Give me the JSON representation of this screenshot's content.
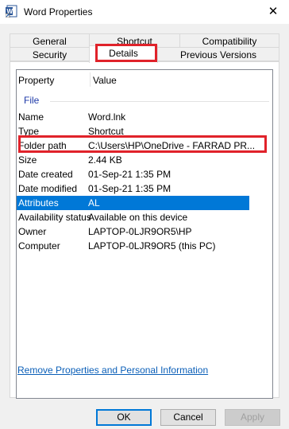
{
  "window": {
    "title": "Word Properties",
    "close_glyph": "✕"
  },
  "tabs": {
    "row1": [
      "General",
      "Shortcut",
      "Compatibility"
    ],
    "row2": [
      "Security",
      "Details",
      "Previous Versions"
    ],
    "active": "Details"
  },
  "columns": {
    "property": "Property",
    "value": "Value"
  },
  "group": "File",
  "rows": [
    {
      "property": "Name",
      "value": "Word.lnk"
    },
    {
      "property": "Type",
      "value": "Shortcut"
    },
    {
      "property": "Folder path",
      "value": "C:\\Users\\HP\\OneDrive - FARRAD PR..."
    },
    {
      "property": "Size",
      "value": "2.44 KB"
    },
    {
      "property": "Date created",
      "value": "01-Sep-21 1:35 PM"
    },
    {
      "property": "Date modified",
      "value": "01-Sep-21 1:35 PM"
    },
    {
      "property": "Attributes",
      "value": "AL"
    },
    {
      "property": "Availability status",
      "value": "Available on this device"
    },
    {
      "property": "Owner",
      "value": "LAPTOP-0LJR9OR5\\HP"
    },
    {
      "property": "Computer",
      "value": "LAPTOP-0LJR9OR5 (this PC)"
    }
  ],
  "selected_row": "Attributes",
  "remove_link": "Remove Properties and Personal Information",
  "buttons": {
    "ok": "OK",
    "cancel": "Cancel",
    "apply": "Apply"
  },
  "colors": {
    "selection": "#0078d7",
    "annotation": "#e0222a",
    "link": "#0b5fb8"
  },
  "icons": {
    "app": "word-shortcut-icon",
    "close": "close-icon"
  }
}
